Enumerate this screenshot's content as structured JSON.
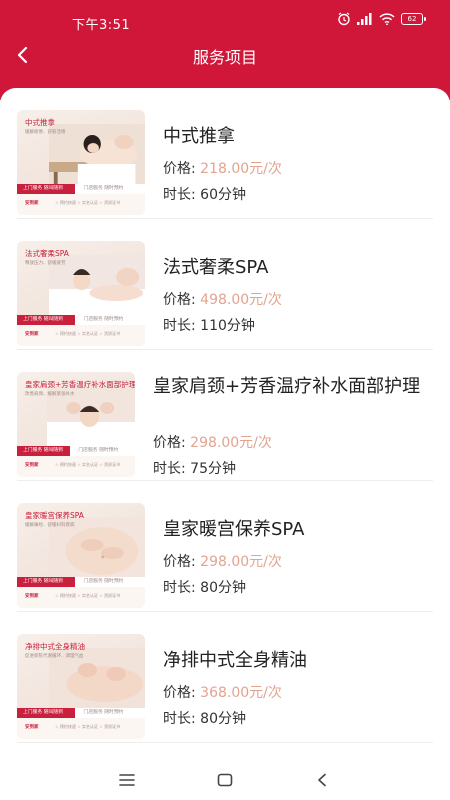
{
  "status_bar": {
    "time": "下午3:51",
    "battery": "62"
  },
  "header": {
    "title": "服务项目"
  },
  "common": {
    "price_label": "价格:",
    "duration_label": "时长:"
  },
  "services": [
    {
      "name": "中式推拿",
      "price": "218.00元/次",
      "duration": "60分钟",
      "thumb": {
        "title": "中式推拿",
        "subtitle": "缓解疲倦、舒筋活络",
        "strip_left": "上门服务  随叫随到",
        "strip_right": "门店服务  随时预约",
        "logo": "安到家",
        "tags": "☆ 预约快速   ☆ 实名认证   ☆ 资质证书"
      }
    },
    {
      "name": "法式奢柔SPA",
      "price": "498.00元/次",
      "duration": "110分钟",
      "thumb": {
        "title": "法式奢柔SPA",
        "subtitle": "释放压力、舒缓疲劳",
        "strip_left": "上门服务  随叫随到",
        "strip_right": "门店服务  随时预约",
        "logo": "安到家",
        "tags": "☆ 预约快速   ☆ 实名认证   ☆ 资质证书"
      }
    },
    {
      "name": "皇家肩颈+芳香温疗补水面部护理",
      "price": "298.00元/次",
      "duration": "75分钟",
      "thumb": {
        "title": "皇家肩颈+芳香温疗补水面部护理",
        "subtitle": "改善肩颈、缓解紧张补水",
        "strip_left": "上门服务  随叫随到",
        "strip_right": "门店服务  随时预约",
        "logo": "安到家",
        "tags": "☆ 预约快速   ☆ 实名认证   ☆ 资质证书"
      }
    },
    {
      "name": "皇家暖宫保养SPA",
      "price": "298.00元/次",
      "duration": "80分钟",
      "thumb": {
        "title": "皇家暖宫保养SPA",
        "subtitle": "缓解痛经、舒缓妇科疾病",
        "strip_left": "上门服务  随叫随到",
        "strip_right": "门店服务  随时预约",
        "logo": "安到家",
        "tags": "☆ 预约快速   ☆ 实名认证   ☆ 资质证书"
      }
    },
    {
      "name": "净排中式全身精油",
      "price": "368.00元/次",
      "duration": "80分钟",
      "thumb": {
        "title": "净排中式全身精油",
        "subtitle": "促进新陈代谢循环、调理气血",
        "strip_left": "上门服务  随叫随到",
        "strip_right": "门店服务  随时预约",
        "logo": "安到家",
        "tags": "☆ 预约快速   ☆ 实名认证   ☆ 资质证书"
      }
    }
  ],
  "colors": {
    "brand": "#d0173a",
    "price": "#e2a48f"
  },
  "icons": [
    "alarm-icon",
    "signal-icon",
    "wifi-icon",
    "battery-icon",
    "back-arrow-icon",
    "menu-icon",
    "home-icon",
    "nav-back-icon"
  ]
}
